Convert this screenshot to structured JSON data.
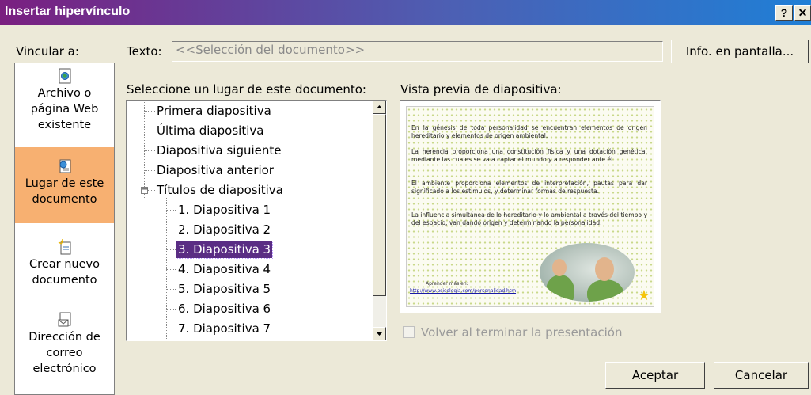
{
  "window": {
    "title": "Insertar hipervínculo",
    "help_label": "?",
    "close_label": "✕"
  },
  "link_to": {
    "label": "Vincular a:",
    "items": [
      {
        "label_lines": [
          "Archivo o",
          "página Web",
          "existente"
        ],
        "icon": "web-page-icon",
        "selected": false
      },
      {
        "label_lines": [
          "Lugar de este",
          "documento"
        ],
        "icon": "place-in-document-icon",
        "selected": true
      },
      {
        "label_lines": [
          "Crear nuevo",
          "documento"
        ],
        "icon": "new-document-icon",
        "selected": false
      },
      {
        "label_lines": [
          "Dirección de",
          "correo",
          "electrónico"
        ],
        "icon": "email-address-icon",
        "selected": false
      }
    ]
  },
  "text_field": {
    "label": "Texto:",
    "value": "<<Selección del documento>>"
  },
  "screentip_button": "Info. en pantalla...",
  "place_list": {
    "label": "Seleccione un lugar de este documento:",
    "items": [
      {
        "label": "Primera diapositiva",
        "level": 0
      },
      {
        "label": "Última diapositiva",
        "level": 0
      },
      {
        "label": "Diapositiva siguiente",
        "level": 0
      },
      {
        "label": "Diapositiva anterior",
        "level": 0
      },
      {
        "label": "Títulos de diapositiva",
        "level": 0,
        "expander": "−"
      },
      {
        "label": "1. Diapositiva 1",
        "level": 1
      },
      {
        "label": "2. Diapositiva 2",
        "level": 1
      },
      {
        "label": "3. Diapositiva 3",
        "level": 1,
        "selected": true
      },
      {
        "label": "4. Diapositiva 4",
        "level": 1
      },
      {
        "label": "5. Diapositiva 5",
        "level": 1
      },
      {
        "label": "6. Diapositiva 6",
        "level": 1
      },
      {
        "label": "7. Diapositiva 7",
        "level": 1
      }
    ]
  },
  "preview": {
    "label": "Vista previa de diapositiva:",
    "slide_paragraphs": [
      "En la génesis de toda personalidad se encuentran elementos de origen hereditario y elementos de origen ambiental.",
      "La herencia proporciona una constitución física y una dotación genética, mediante las cuales se va a captar el mundo y a responder ante él.",
      "El ambiente proporciona elementos de interpretación, pautas para dar significado a los estímulos, y determinar formas de respuesta.",
      "La influencia simultánea de lo hereditario y lo ambiental a través del tiempo y del espacio, van dando origen y determinando la personalidad."
    ],
    "learn_more": "Aprender más en:",
    "link_text": "http://www.psicologia.com/personalidad.htm"
  },
  "return_checkbox": {
    "label": "Volver al terminar la presentación",
    "checked": false
  },
  "buttons": {
    "ok": "Aceptar",
    "cancel": "Cancelar"
  }
}
